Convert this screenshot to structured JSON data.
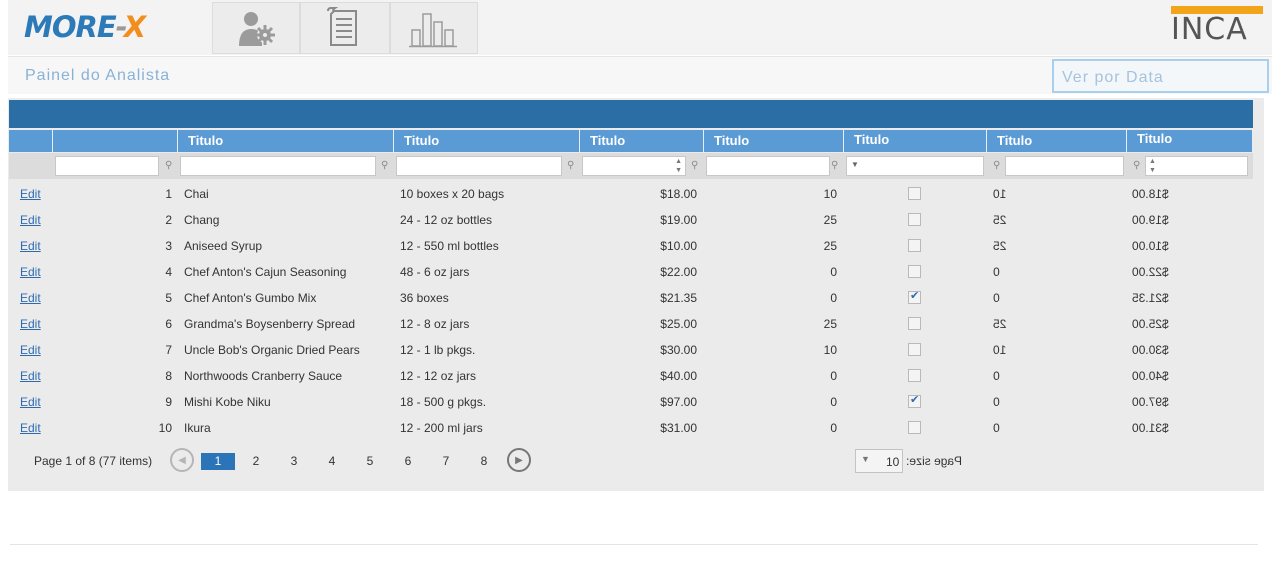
{
  "header": {
    "logo_more": "MORE",
    "logo_dash": "-",
    "logo_x": "X",
    "brand_right": "INCA",
    "nav": [
      {
        "icon": "user-gear-icon"
      },
      {
        "icon": "document-list-icon"
      },
      {
        "icon": "bar-chart-icon"
      }
    ]
  },
  "subheader": {
    "title": "Painel do Analista",
    "date_button": "Ver por Data"
  },
  "grid": {
    "column_header": "Titulo",
    "rows": [
      {
        "edit": "Edit",
        "id": "1",
        "name": "Chai",
        "qty": "10 boxes x 20 bags",
        "price": "$18.00",
        "stock": "10",
        "checked": false,
        "stock_m": "10",
        "price_m": "$18.00"
      },
      {
        "edit": "Edit",
        "id": "2",
        "name": "Chang",
        "qty": "24 - 12 oz bottles",
        "price": "$19.00",
        "stock": "25",
        "checked": false,
        "stock_m": "25",
        "price_m": "$19.00"
      },
      {
        "edit": "Edit",
        "id": "3",
        "name": "Aniseed Syrup",
        "qty": "12 - 550 ml bottles",
        "price": "$10.00",
        "stock": "25",
        "checked": false,
        "stock_m": "25",
        "price_m": "$10.00"
      },
      {
        "edit": "Edit",
        "id": "4",
        "name": "Chef Anton's Cajun Seasoning",
        "qty": "48 - 6 oz jars",
        "price": "$22.00",
        "stock": "0",
        "checked": false,
        "stock_m": "0",
        "price_m": "$22.00"
      },
      {
        "edit": "Edit",
        "id": "5",
        "name": "Chef Anton's Gumbo Mix",
        "qty": "36 boxes",
        "price": "$21.35",
        "stock": "0",
        "checked": true,
        "stock_m": "0",
        "price_m": "$21.35"
      },
      {
        "edit": "Edit",
        "id": "6",
        "name": "Grandma's Boysenberry Spread",
        "qty": "12 - 8 oz jars",
        "price": "$25.00",
        "stock": "25",
        "checked": false,
        "stock_m": "25",
        "price_m": "$25.00"
      },
      {
        "edit": "Edit",
        "id": "7",
        "name": "Uncle Bob's Organic Dried Pears",
        "qty": "12 - 1 lb pkgs.",
        "price": "$30.00",
        "stock": "10",
        "checked": false,
        "stock_m": "10",
        "price_m": "$30.00"
      },
      {
        "edit": "Edit",
        "id": "8",
        "name": "Northwoods Cranberry Sauce",
        "qty": "12 - 12 oz jars",
        "price": "$40.00",
        "stock": "0",
        "checked": false,
        "stock_m": "0",
        "price_m": "$40.00"
      },
      {
        "edit": "Edit",
        "id": "9",
        "name": "Mishi Kobe Niku",
        "qty": "18 - 500 g pkgs.",
        "price": "$97.00",
        "stock": "0",
        "checked": true,
        "stock_m": "0",
        "price_m": "$97.00"
      },
      {
        "edit": "Edit",
        "id": "10",
        "name": "Ikura",
        "qty": "12 - 200 ml jars",
        "price": "$31.00",
        "stock": "0",
        "checked": false,
        "stock_m": "0",
        "price_m": "$31.00"
      }
    ]
  },
  "pager": {
    "info": "Page 1 of 8 (77 items)",
    "pages": [
      "1",
      "2",
      "3",
      "4",
      "5",
      "6",
      "7",
      "8"
    ],
    "current": "1",
    "page_size_label": "Page size:",
    "page_size": "10"
  },
  "colors": {
    "header_blue": "#2b6ea6",
    "column_blue": "#5b9bd5",
    "link": "#2d6bb1",
    "logo_orange": "#f28e1e",
    "inca_bar": "#f3a51a"
  }
}
